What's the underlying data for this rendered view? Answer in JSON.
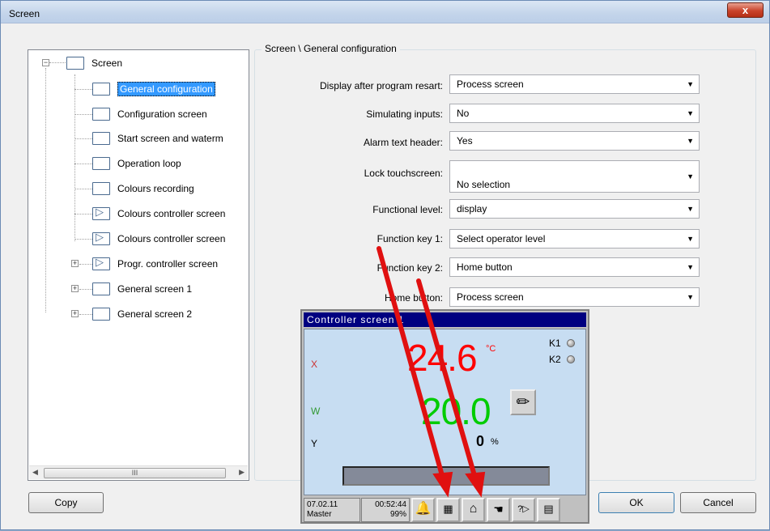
{
  "window": {
    "title": "Screen",
    "close_label": "x"
  },
  "tree": {
    "root": "Screen",
    "items": [
      {
        "label": "General configuration"
      },
      {
        "label": "Configuration screen"
      },
      {
        "label": "Start screen and waterm"
      },
      {
        "label": "Operation loop"
      },
      {
        "label": "Colours recording"
      },
      {
        "label": "Colours controller screen"
      },
      {
        "label": "Colours controller screen"
      },
      {
        "label": "Progr. controller screen"
      },
      {
        "label": "General screen 1"
      },
      {
        "label": "General screen 2"
      }
    ],
    "scroll_grip": "III"
  },
  "config": {
    "group_title": "Screen \\ General configuration",
    "rows": [
      {
        "label": "Display after program resart:",
        "value": "Process screen"
      },
      {
        "label": "Simulating inputs:",
        "value": "No"
      },
      {
        "label": "Alarm text header:",
        "value": "Yes"
      },
      {
        "label": "Lock touchscreen:",
        "value": "No selection"
      },
      {
        "label": "Functional level:",
        "value": "display"
      },
      {
        "label": "Function key 1:",
        "value": "Select operator level"
      },
      {
        "label": "Function key 2:",
        "value": "Home button"
      },
      {
        "label": "Home button:",
        "value": "Process screen"
      }
    ]
  },
  "controller_screen": {
    "title": "Controller screen 1",
    "x_label": "X",
    "w_label": "W",
    "y_label": "Y",
    "x_value": "24.6",
    "x_unit": "°C",
    "w_value": "20.0",
    "y_value": "0",
    "y_unit": "%",
    "k1": "K1",
    "k2": "K2",
    "date": "07.02.11",
    "time": "00:52:44",
    "user": "Master",
    "memory": "99%"
  },
  "buttons": {
    "copy": "Copy",
    "ok": "OK",
    "cancel": "Cancel"
  },
  "colors": {
    "arrow": "#e01010",
    "selection": "#3399ff",
    "x_value": "#ff0000",
    "w_value": "#00cc00"
  }
}
